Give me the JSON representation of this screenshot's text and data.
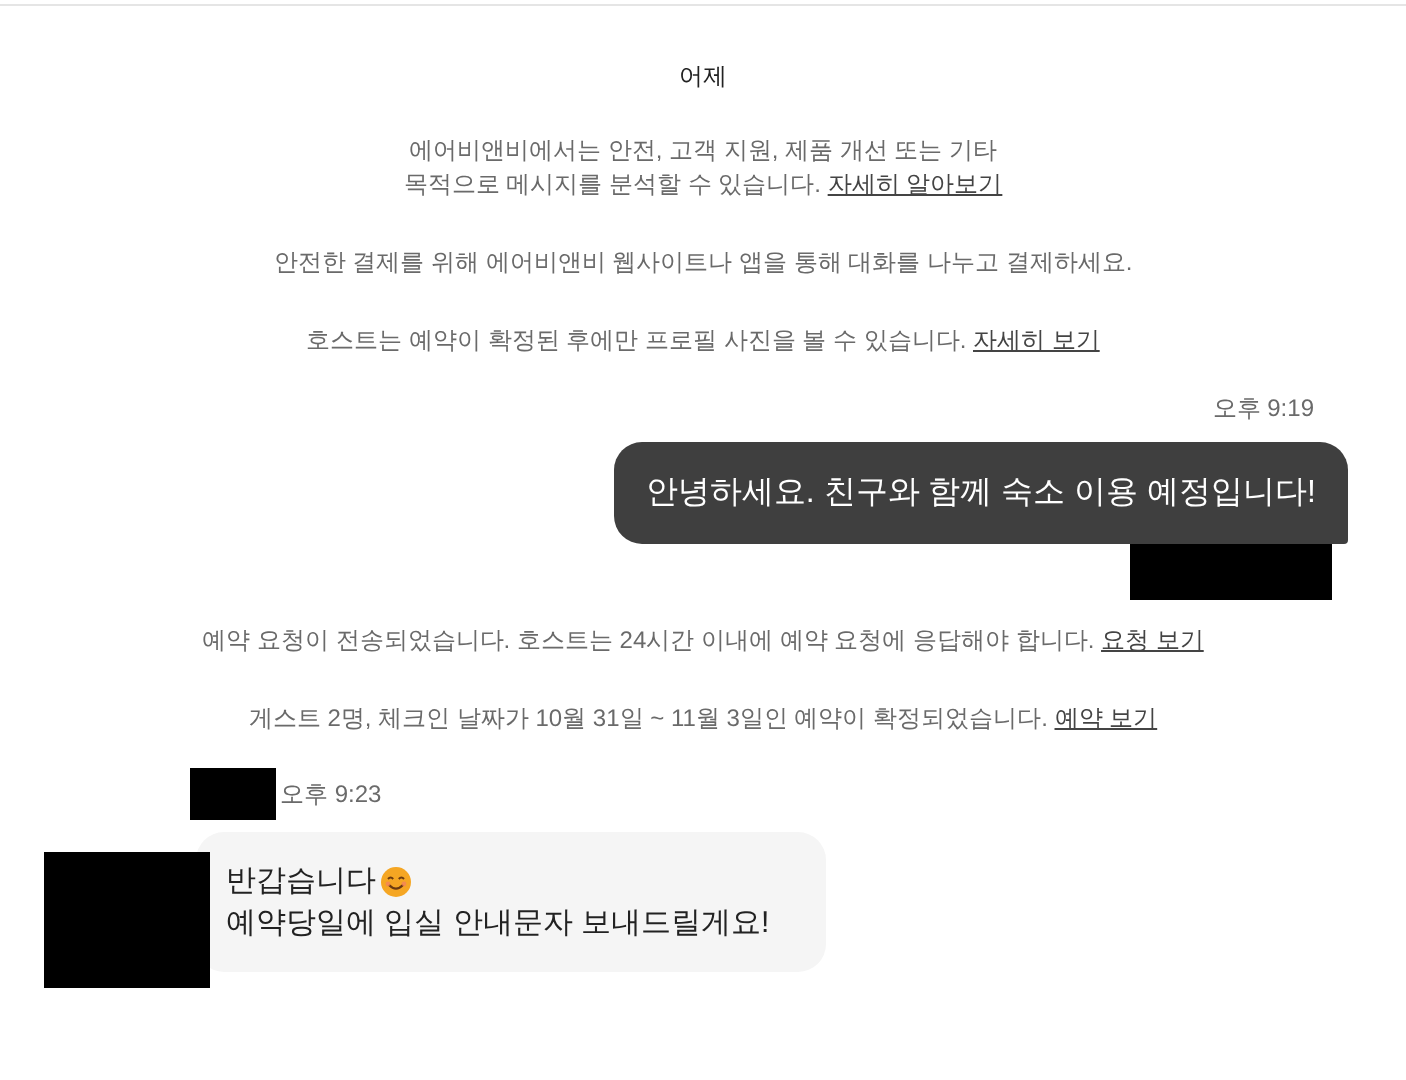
{
  "date_divider": "어제",
  "notices_top": [
    {
      "text": "에어비앤비에서는 안전, 고객 지원, 제품 개선 또는 기타\n목적으로 메시지를 분석할 수 있습니다.",
      "link": "자세히 알아보기"
    },
    {
      "text": "안전한 결제를 위해 에어비앤비 웹사이트나 앱을 통해 대화를 나누고 결제하세요."
    },
    {
      "text": "호스트는 예약이 확정된 후에만 프로필 사진을 볼 수 있습니다.",
      "link": "자세히 보기"
    }
  ],
  "outgoing": {
    "time": "오후 9:19",
    "text": "안녕하세요. 친구와 함께 숙소 이용 예정입니다!"
  },
  "notices_bottom": [
    {
      "text": "예약 요청이 전송되었습니다. 호스트는 24시간 이내에 예약 요청에 응답해야 합니다.",
      "link": "요청 보기"
    },
    {
      "text": "게스트 2명, 체크인 날짜가 10월 31일 ~ 11월 3일인 예약이 확정되었습니다.",
      "link": "예약 보기"
    }
  ],
  "incoming": {
    "time": "오후 9:23",
    "lines": [
      "반갑습니다",
      "예약당일에 입실 안내문자 보내드릴게요!"
    ]
  }
}
